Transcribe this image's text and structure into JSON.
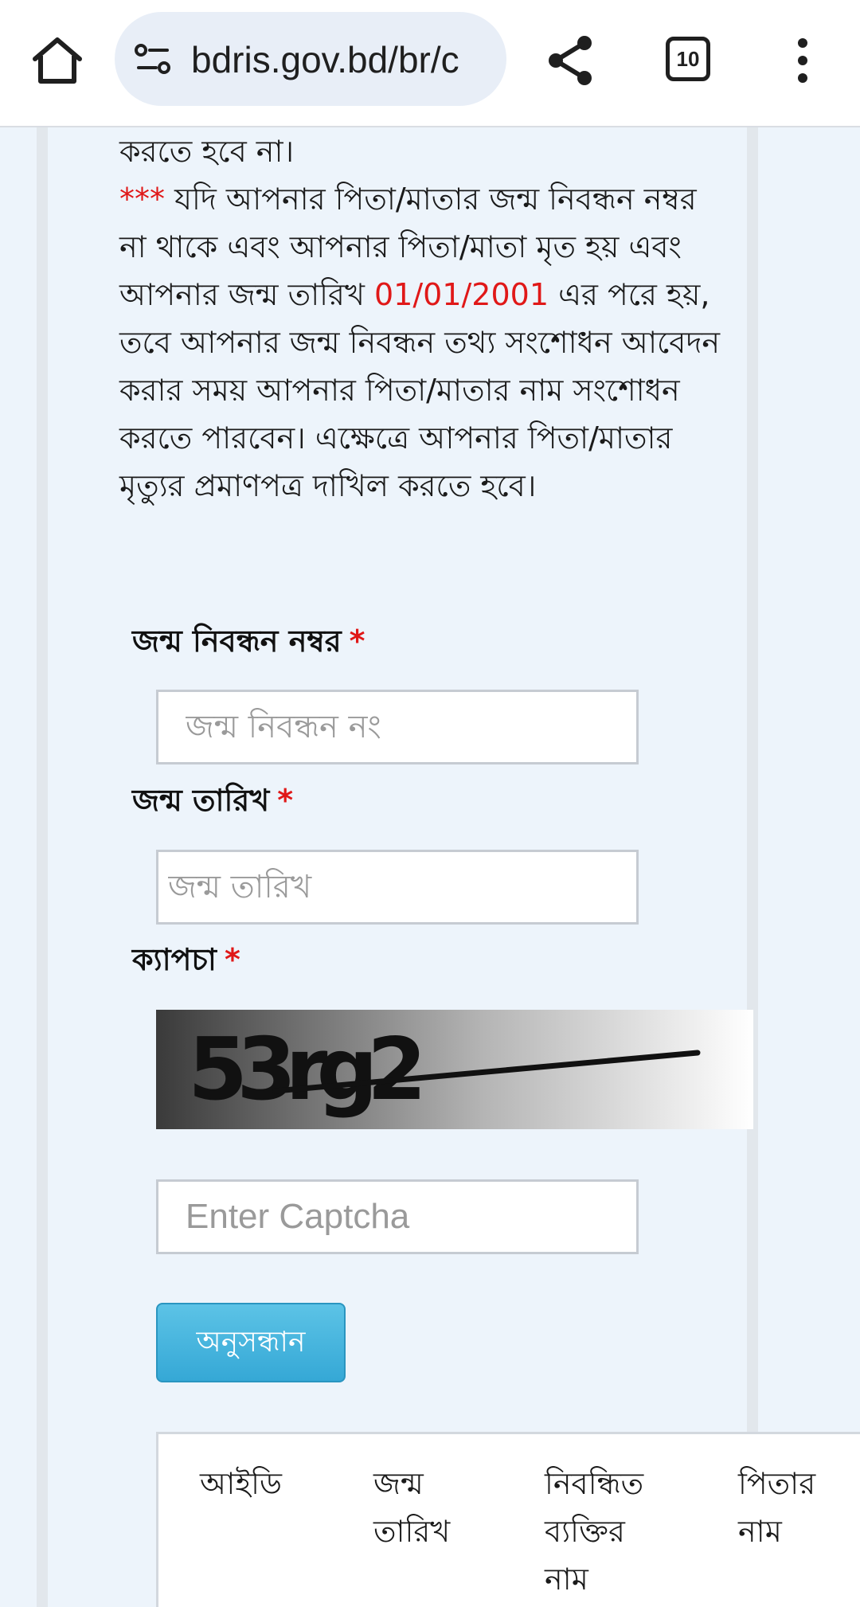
{
  "browser": {
    "url": "bdris.gov.bd/br/c",
    "tab_count": "10"
  },
  "notice": {
    "line1": "করতে হবে না।",
    "stars": "***",
    "para_start": " যদি আপনার পিতা/মাতার জন্ম নিবন্ধন নম্বর না থাকে এবং আপনার পিতা/মাতা মৃত হয় এবং আপনার জন্ম তারিখ ",
    "date": "01/01/2001",
    "para_end": " এর পরে হয়, তবে আপনার জন্ম নিবন্ধন তথ্য সংশোধন আবেদন করার সময় আপনার পিতা/মাতার নাম সংশোধন করতে পারবেন। এক্ষেত্রে আপনার পিতা/মাতার মৃত্যুর প্রমাণপত্র দাখিল করতে হবে।"
  },
  "form": {
    "brn_label": "জন্ম নিবন্ধন নম্বর",
    "brn_placeholder": "জন্ম নিবন্ধন নং",
    "dob_label": "জন্ম তারিখ",
    "dob_placeholder": "জন্ম তারিখ",
    "captcha_label": "ক্যাপচা",
    "captcha_image_text": "53rg2",
    "captcha_placeholder": "Enter Captcha",
    "required_mark": "*",
    "search_label": "অনুসন্ধান"
  },
  "results_table": {
    "headers": [
      "আইডি",
      "জন্ম তারিখ",
      "নিবন্ধিত ব্যক্তির নাম",
      "পিতার নাম"
    ]
  },
  "colors": {
    "accent_red": "#e01818",
    "button_blue": "#35a8d6"
  }
}
